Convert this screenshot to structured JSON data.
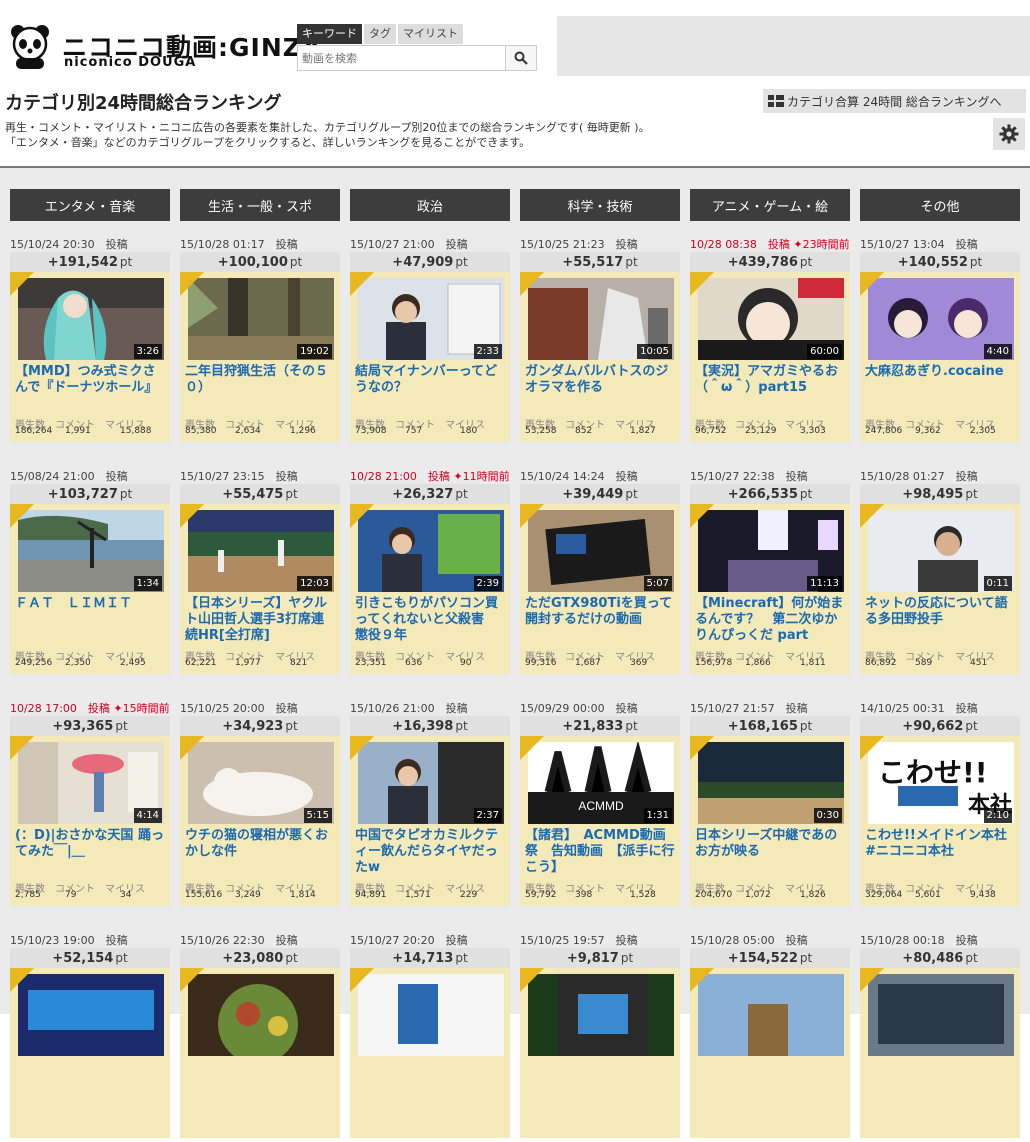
{
  "header": {
    "logo_main": "ニコニコ動画:GINZA",
    "logo_sub": "niconico DOUGA",
    "search_tabs": [
      "キーワード",
      "タグ",
      "マイリスト"
    ],
    "search_placeholder": "動画を検索"
  },
  "page": {
    "title": "カテゴリ別24時間総合ランキング",
    "desc1": "再生・コメント・マイリスト・ニコニ広告の各要素を集計した、カテゴリグループ別20位までの総合ランキングです( 毎時更新 )。",
    "desc2": "「エンタメ・音楽」などのカテゴリグループをクリックすると、詳しいランキングを見ることができます。",
    "all_ranking_btn": "カテゴリ合算 24時間 総合ランキングへ"
  },
  "stat_labels": [
    "再生数",
    "コメント",
    "マイリス"
  ],
  "categories": [
    "エンタメ・音楽",
    "生活・一般・スポ",
    "政治",
    "科学・技術",
    "アニメ・ゲーム・絵",
    "その他"
  ],
  "cards": [
    [
      {
        "date": "15/10/24 20:30",
        "posted": "投稿",
        "pts": "+191,542",
        "dur": "3:26",
        "title": "【MMD】つみ式ミクさんで『ドーナツホール』",
        "views": "186,264",
        "comments": "1,991",
        "mylists": "15,888",
        "thumb": "miku"
      },
      {
        "date": "15/08/24 21:00",
        "posted": "投稿",
        "pts": "+103,727",
        "dur": "1:34",
        "title": "ＦＡＴ　ＬＩＭＩＴ",
        "views": "249,256",
        "comments": "2,350",
        "mylists": "2,495",
        "thumb": "sea"
      },
      {
        "date": "10/28 17:00",
        "posted": "投稿",
        "ago": "✦15時間前",
        "pts": "+93,365",
        "dur": "4:14",
        "title": "(：D)|おさかな天国 踊ってみた￣|＿",
        "views": "2,785",
        "comments": "79",
        "mylists": "34",
        "thumb": "room",
        "red": true
      },
      {
        "date": "15/10/23 19:00",
        "posted": "投稿",
        "pts": "+52,154",
        "thumb": "blue"
      }
    ],
    [
      {
        "date": "15/10/28 01:17",
        "posted": "投稿",
        "pts": "+100,100",
        "dur": "19:02",
        "title": "二年目狩猟生活（その５０）",
        "views": "85,380",
        "comments": "2,634",
        "mylists": "1,296",
        "thumb": "forest"
      },
      {
        "date": "15/10/27 23:15",
        "posted": "投稿",
        "pts": "+55,475",
        "dur": "12:03",
        "title": "【日本シリーズ】ヤクルト山田哲人選手3打席連続HR[全打席]",
        "views": "62,221",
        "comments": "1,977",
        "mylists": "821",
        "thumb": "baseball"
      },
      {
        "date": "15/10/25 20:00",
        "posted": "投稿",
        "pts": "+34,923",
        "dur": "5:15",
        "title": "ウチの猫の寝相が悪くおかしな件",
        "views": "155,616",
        "comments": "3,249",
        "mylists": "1,814",
        "thumb": "cat"
      },
      {
        "date": "15/10/26 22:30",
        "posted": "投稿",
        "pts": "+23,080",
        "thumb": "food"
      }
    ],
    [
      {
        "date": "15/10/27 21:00",
        "posted": "投稿",
        "pts": "+47,909",
        "dur": "2:33",
        "title": "結局マイナンバーってどうなの？",
        "views": "73,908",
        "comments": "757",
        "mylists": "180",
        "thumb": "news"
      },
      {
        "date": "10/28 21:00",
        "posted": "投稿",
        "ago": "✦11時間前",
        "pts": "+26,327",
        "dur": "2:39",
        "title": "引きこもりがパソコン買ってくれないと父殺害　懲役９年",
        "views": "23,351",
        "comments": "636",
        "mylists": "90",
        "thumb": "news2",
        "red": true
      },
      {
        "date": "15/10/26 21:00",
        "posted": "投稿",
        "pts": "+16,398",
        "dur": "2:37",
        "title": "中国でタピオカミルクティー飲んだらタイヤだったw",
        "views": "94,891",
        "comments": "1,571",
        "mylists": "229",
        "thumb": "news3"
      },
      {
        "date": "15/10/27 20:20",
        "posted": "投稿",
        "pts": "+14,713",
        "thumb": "white"
      }
    ],
    [
      {
        "date": "15/10/25 21:23",
        "posted": "投稿",
        "pts": "+55,517",
        "dur": "10:05",
        "title": "ガンダムバルバトスのジオラマを作る",
        "views": "53,258",
        "comments": "852",
        "mylists": "1,827",
        "thumb": "gundam"
      },
      {
        "date": "15/10/24 14:24",
        "posted": "投稿",
        "pts": "+39,449",
        "dur": "5:07",
        "title": "ただGTX980Tiを買って開封するだけの動画",
        "views": "99,316",
        "comments": "1,687",
        "mylists": "369",
        "thumb": "gpu"
      },
      {
        "date": "15/09/29 00:00",
        "posted": "投稿",
        "pts": "+21,833",
        "dur": "1:31",
        "title": "【諸君】　ACMMD動画祭　告知動画　【派手に行こう】",
        "views": "59,792",
        "comments": "398",
        "mylists": "1,528",
        "thumb": "acmmd"
      },
      {
        "date": "15/10/25 19:57",
        "posted": "投稿",
        "pts": "+9,817",
        "thumb": "game"
      }
    ],
    [
      {
        "date": "10/28 08:38",
        "posted": "投稿",
        "ago": "✦23時間前",
        "pts": "+439,786",
        "dur": "60:00",
        "title": "【実況】アマガミやるお（＾ω＾）part15",
        "views": "96,752",
        "comments": "25,129",
        "mylists": "3,303",
        "thumb": "anime",
        "red": true
      },
      {
        "date": "15/10/27 22:38",
        "posted": "投稿",
        "pts": "+266,535",
        "dur": "11:13",
        "title": "【Minecraft】何が始まるんです？　第二次ゆかりんぴっくだ part",
        "views": "156,978",
        "comments": "1,866",
        "mylists": "1,811",
        "thumb": "mc"
      },
      {
        "date": "15/10/27 21:57",
        "posted": "投稿",
        "pts": "+168,165",
        "dur": "0:30",
        "title": "日本シリーズ中継であのお方が映る",
        "views": "204,670",
        "comments": "1,072",
        "mylists": "1,826",
        "thumb": "stadium"
      },
      {
        "date": "15/10/28 05:00",
        "posted": "投稿",
        "pts": "+154,522",
        "thumb": "mc2"
      }
    ],
    [
      {
        "date": "15/10/27 13:04",
        "posted": "投稿",
        "pts": "+140,552",
        "dur": "4:40",
        "title": "大麻忍あぎり.cocaine",
        "views": "247,806",
        "comments": "9,362",
        "mylists": "2,305",
        "thumb": "anime2"
      },
      {
        "date": "15/10/28 01:27",
        "posted": "投稿",
        "pts": "+98,495",
        "dur": "0:11",
        "title": "ネットの反応について語る多田野投手",
        "views": "86,892",
        "comments": "589",
        "mylists": "451",
        "thumb": "man"
      },
      {
        "date": "14/10/25 00:31",
        "posted": "投稿",
        "pts": "+90,662",
        "dur": "2:10",
        "title": "こわせ!!メイドイン本社　#ニコニコ本社",
        "views": "329,064",
        "comments": "5,601",
        "mylists": "9,438",
        "thumb": "logo"
      },
      {
        "date": "15/10/28 00:18",
        "posted": "投稿",
        "pts": "+80,486",
        "thumb": "office"
      }
    ]
  ]
}
